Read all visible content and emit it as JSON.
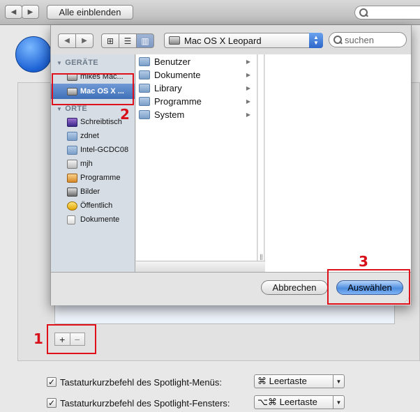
{
  "toolbar": {
    "back_icon": "◀",
    "forward_icon": "▶",
    "show_all_label": "Alle einblenden"
  },
  "sheet": {
    "nav_back": "◀",
    "nav_forward": "▶",
    "view_icons": [
      "⊞",
      "☰",
      "▥"
    ],
    "location": "Mac OS X Leopard",
    "search_placeholder": "suchen",
    "sidebar": {
      "devices_header": "GERÄTE",
      "devices": [
        {
          "label": "mikes Mac...",
          "icon": "hard-disk-icon"
        },
        {
          "label": "Mac OS X ...",
          "icon": "hard-disk-icon",
          "selected": true
        }
      ],
      "places_header": "ORTE",
      "places": [
        {
          "label": "Schreibtisch",
          "icon": "desktop-icon"
        },
        {
          "label": "zdnet",
          "icon": "folder-icon"
        },
        {
          "label": "Intel-GCDC08",
          "icon": "folder-icon"
        },
        {
          "label": "mjh",
          "icon": "home-icon"
        },
        {
          "label": "Programme",
          "icon": "applications-icon"
        },
        {
          "label": "Bilder",
          "icon": "pictures-icon"
        },
        {
          "label": "Öffentlich",
          "icon": "public-icon"
        },
        {
          "label": "Dokumente",
          "icon": "documents-icon"
        }
      ]
    },
    "column_items": [
      {
        "label": "Benutzer"
      },
      {
        "label": "Dokumente"
      },
      {
        "label": "Library"
      },
      {
        "label": "Programme"
      },
      {
        "label": "System"
      }
    ],
    "cancel_label": "Abbrechen",
    "choose_label": "Auswählen"
  },
  "plus_label": "+",
  "minus_label": "−",
  "shortcuts": [
    {
      "checked": true,
      "label": "Tastaturkurzbefehl des Spotlight-Menüs:",
      "value": "⌘ Leertaste"
    },
    {
      "checked": true,
      "label": "Tastaturkurzbefehl des Spotlight-Fensters:",
      "value": "⌥⌘ Leertaste"
    }
  ],
  "annotations": {
    "num1": "1",
    "num2": "2",
    "num3": "3"
  },
  "colors": {
    "annotation_red": "#e0101a",
    "selection_blue": "#3f6fb8",
    "default_button_blue": "#4f8ee0"
  }
}
